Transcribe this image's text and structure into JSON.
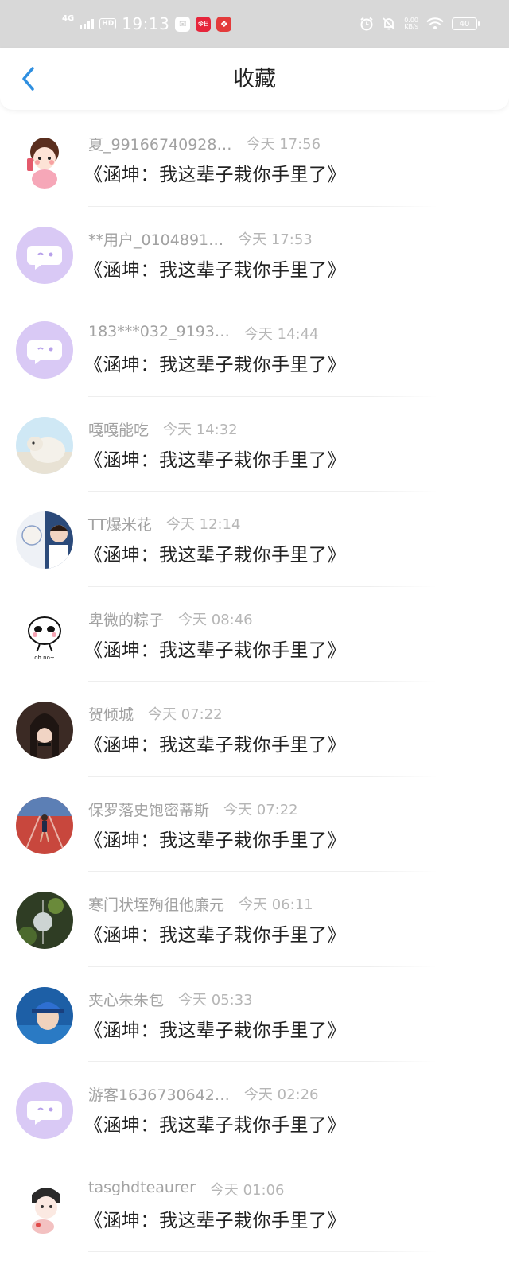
{
  "status_bar": {
    "network": "4G",
    "hd": "HD",
    "time": "19:13",
    "app_badge_1": "今日",
    "speed_value": "0.00",
    "speed_unit": "KB/s",
    "battery": "40"
  },
  "header": {
    "title": "收藏",
    "back_icon": "chevron-left-icon"
  },
  "items": [
    {
      "name": "夏_99166740928…",
      "time": "今天 17:56",
      "message": "《涵坤：我这辈子栽你手里了》",
      "avatar": "cartoon-girl"
    },
    {
      "name": "**用户_0104891…",
      "time": "今天 17:53",
      "message": "《涵坤：我这辈子栽你手里了》",
      "avatar": "default-chat"
    },
    {
      "name": "183***032_9193…",
      "time": "今天 14:44",
      "message": "《涵坤：我这辈子栽你手里了》",
      "avatar": "default-chat"
    },
    {
      "name": "嘎嘎能吃",
      "time": "今天 14:32",
      "message": "《涵坤：我这辈子栽你手里了》",
      "avatar": "sheep-photo"
    },
    {
      "name": "TT爆米花",
      "time": "今天 12:14",
      "message": "《涵坤：我这辈子栽你手里了》",
      "avatar": "boy-drawing"
    },
    {
      "name": "卑微的粽子",
      "time": "今天 08:46",
      "message": "《涵坤：我这辈子栽你手里了》",
      "avatar": "oh-no-face"
    },
    {
      "name": "贺倾城",
      "time": "今天 07:22",
      "message": "《涵坤：我这辈子栽你手里了》",
      "avatar": "girl-portrait"
    },
    {
      "name": "保罗落史饱密蒂斯",
      "time": "今天 07:22",
      "message": "《涵坤：我这辈子栽你手里了》",
      "avatar": "runner-track"
    },
    {
      "name": "寒门状垤殉徂他廉元",
      "time": "今天 06:11",
      "message": "《涵坤：我这辈子栽你手里了》",
      "avatar": "wind-chime"
    },
    {
      "name": "夹心朱朱包",
      "time": "今天 05:33",
      "message": "《涵坤：我这辈子栽你手里了》",
      "avatar": "boy-blue-cap"
    },
    {
      "name": "游客1636730642…",
      "time": "今天 02:26",
      "message": "《涵坤：我这辈子栽你手里了》",
      "avatar": "default-chat"
    },
    {
      "name": "tasghdteaurer",
      "time": "今天 01:06",
      "message": "《涵坤：我这辈子栽你手里了》",
      "avatar": "anime-girl"
    }
  ],
  "colors": {
    "status_bar_bg": "#d8d8d8",
    "back_icon": "#2f8fe0",
    "default_avatar_bg": "#d9c9f5",
    "name_text": "#a2a2a2",
    "message_text": "#222222"
  }
}
